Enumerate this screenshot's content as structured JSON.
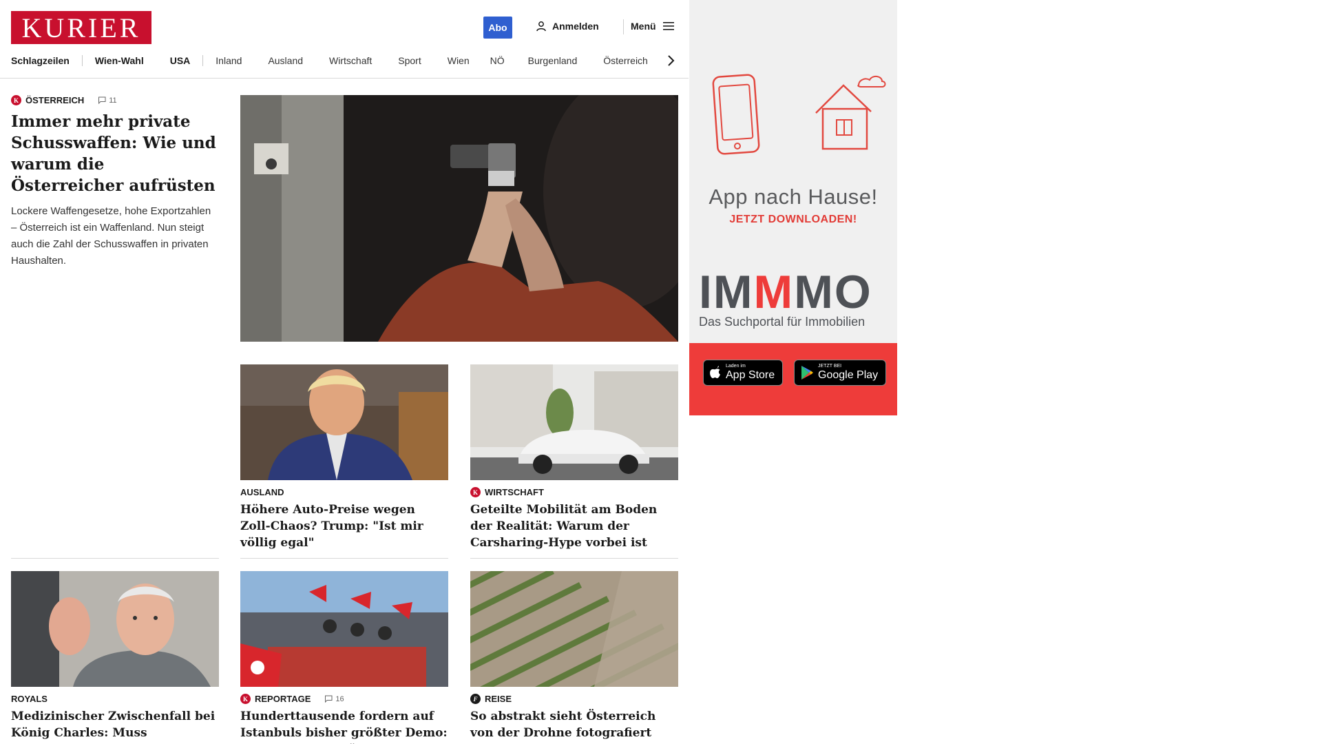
{
  "header": {
    "logo": "KURIER",
    "abo": "Abo",
    "login": "Anmelden",
    "menu": "Menü"
  },
  "nav": [
    "Schlagzeilen",
    "Wien-Wahl",
    "USA",
    "Inland",
    "Ausland",
    "Wirtschaft",
    "Sport",
    "Wien",
    "NÖ",
    "Burgenland",
    "Österreich"
  ],
  "lead": {
    "kicker": "Österreich",
    "comments": "11",
    "title": "Immer mehr private Schusswaffen: Wie und warum die Österreicher aufrüsten",
    "teaser": "Lockere Waffengesetze, hohe Exportzahlen – Österreich ist ein Waffenland. Nun steigt auch die Zahl der Schusswaffen in privaten Haushalten."
  },
  "cards": [
    {
      "kicker": "Ausland",
      "title": "Höhere Auto-Preise wegen Zoll-Chaos? Trump: \"Ist mir völlig egal\""
    },
    {
      "kicker": "Wirtschaft",
      "title": "Geteilte Mobilität am Boden der Realität: Warum der Carsharing-Hype vorbei ist"
    },
    {
      "kicker": "Royals",
      "title": "Medizinischer Zwischenfall bei König Charles: Muss Großbritannien sich jetzt sorgen?"
    },
    {
      "kicker": "Reportage",
      "comments": "16",
      "title": "Hunderttausende fordern auf Istanbuls bisher größter Demo: \"Tayyip, tritt zurück!\""
    },
    {
      "kicker": "Reise",
      "title": "So abstrakt sieht Österreich von der Drohne fotografiert aus"
    }
  ],
  "ad": {
    "headline": "App nach Hause!",
    "cta": "JETZT DOWNLOADEN!",
    "brand_a": "IM",
    "brand_b": "M",
    "brand_c": "MO",
    "tagline": "Das Suchportal für Immobilien",
    "appstore_small": "Laden im",
    "appstore_big": "App Store",
    "play_small": "JETZT BEI",
    "play_big": "Google Play"
  },
  "colors": {
    "brand_red": "#c8102e",
    "abo_blue": "#2f5fd0",
    "ad_red": "#ee3c3a"
  }
}
